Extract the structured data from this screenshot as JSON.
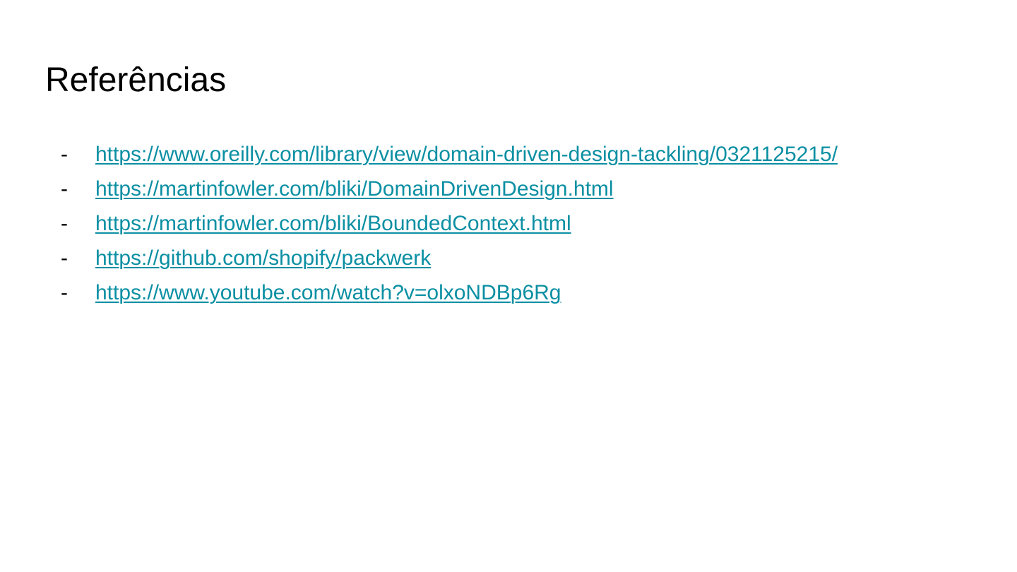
{
  "slide": {
    "title": "Referências",
    "accent_color": "#0b8fa3",
    "references": [
      {
        "bullet": "-",
        "url": "https://www.oreilly.com/library/view/domain-driven-design-tackling/0321125215/"
      },
      {
        "bullet": "-",
        "url": "https://martinfowler.com/bliki/DomainDrivenDesign.html"
      },
      {
        "bullet": "-",
        "url": "https://martinfowler.com/bliki/BoundedContext.html"
      },
      {
        "bullet": "-",
        "url": "https://github.com/shopify/packwerk"
      },
      {
        "bullet": "-",
        "url": "https://www.youtube.com/watch?v=olxoNDBp6Rg"
      }
    ]
  }
}
